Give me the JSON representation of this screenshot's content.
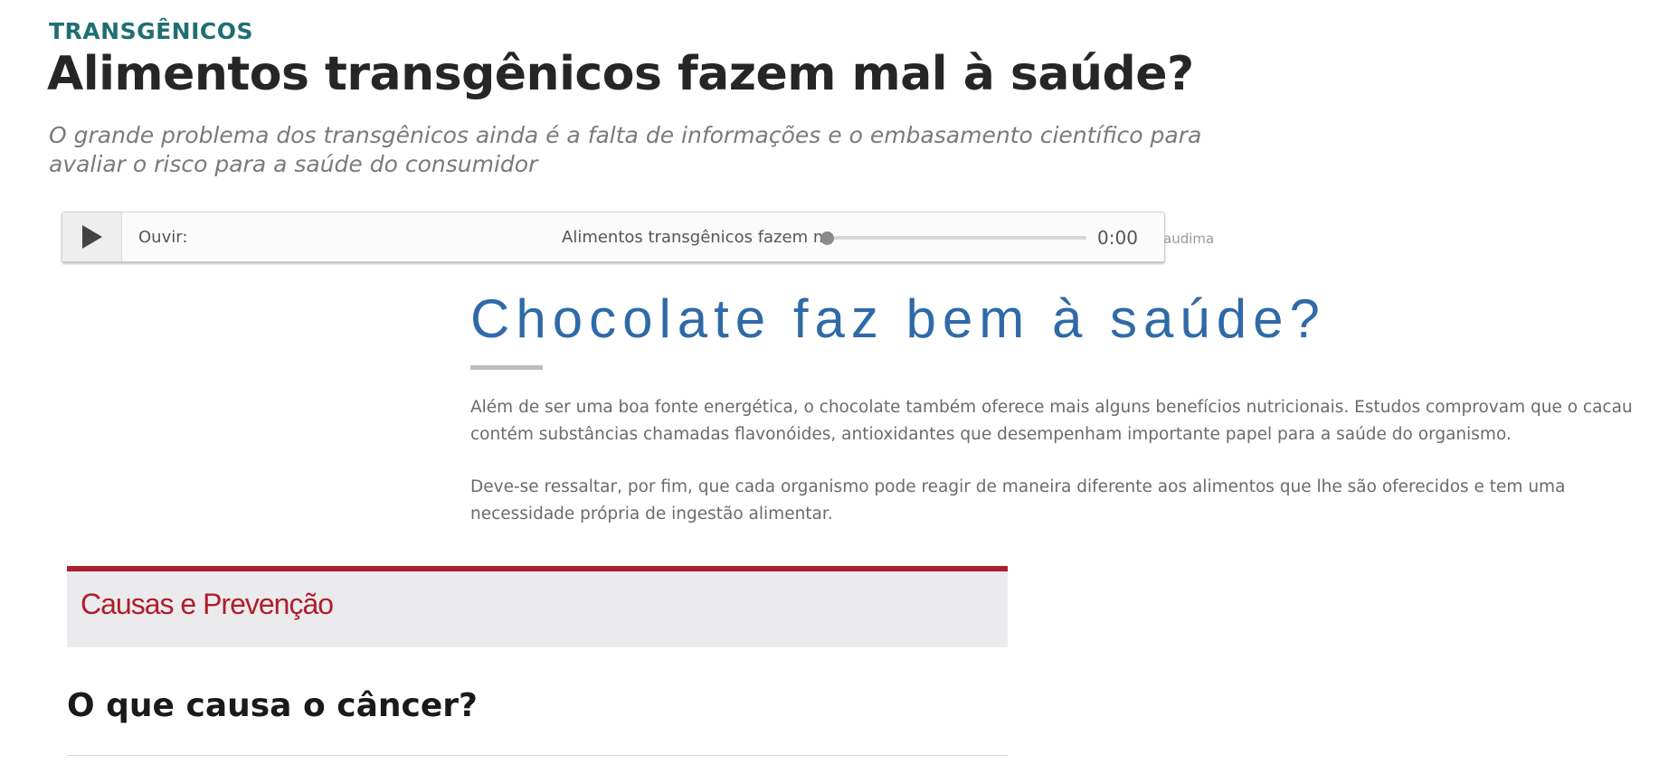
{
  "article": {
    "category": "TRANSGÊNICOS",
    "headline": "Alimentos transgênicos fazem mal à saúde?",
    "subheadline": "O grande problema dos transgênicos ainda é a falta de informações e o embasamento científico para avaliar o risco para a saúde do consumidor"
  },
  "player": {
    "play_icon": "play-icon",
    "label": "Ouvir:",
    "track_title": "Alimentos transgênicos fazem mal à saúde?",
    "progress_fraction": 0,
    "time": "0:00",
    "brand": "audima"
  },
  "section": {
    "title": "Chocolate faz bem à saúde?",
    "paragraphs": [
      "Além de ser uma boa fonte energética, o chocolate também oferece mais alguns benefícios nutricionais. Estudos comprovam que o cacau contém substâncias chamadas flavonóides, antioxidantes que desempenham importante papel para a saúde do organismo.",
      "Deve-se ressaltar, por fim, que cada organismo pode reagir de maneira diferente aos alimentos que lhe são oferecidos e tem uma necessidade própria de ingestão alimentar."
    ]
  },
  "box": {
    "title": "Causas e Prevenção",
    "accent_color": "#b01d2c"
  },
  "faq": {
    "question": "O que causa o câncer?"
  }
}
